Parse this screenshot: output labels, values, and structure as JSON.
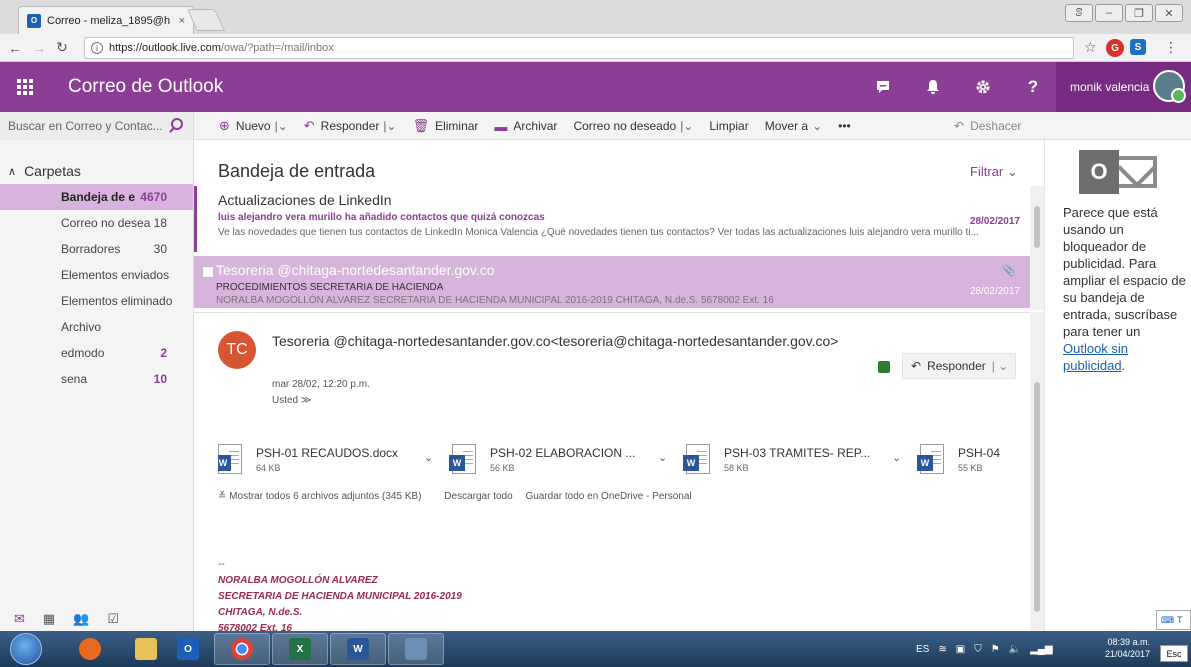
{
  "browser": {
    "tab_title": "Correo - meliza_1895@h",
    "tab_close": "×",
    "favicon": "O",
    "url_host": "https://outlook.live.com",
    "url_path": "/owa/?path=/mail/inbox",
    "win_buttons": [
      "ꕷ",
      "–",
      "❐",
      "✕"
    ]
  },
  "header": {
    "app_title": "Correo de Outlook",
    "user_name": "monik valencia",
    "icons": [
      "chat-icon",
      "bell-icon",
      "gear-icon",
      "help-icon"
    ],
    "help_glyph": "?"
  },
  "search": {
    "placeholder": "Buscar en Correo y Contac..."
  },
  "toolbar": {
    "new": "Nuevo",
    "reply": "Responder",
    "delete": "Eliminar",
    "archive": "Archivar",
    "junk": "Correo no deseado",
    "sweep": "Limpiar",
    "move": "Mover a",
    "more": "•••",
    "undo": "Deshacer"
  },
  "folders": {
    "header": "Carpetas",
    "items": [
      {
        "label": "Bandeja de e",
        "count": "4670"
      },
      {
        "label": "Correo no desea",
        "count": "18"
      },
      {
        "label": "Borradores",
        "count": "30"
      },
      {
        "label": "Elementos enviados",
        "count": ""
      },
      {
        "label": "Elementos eliminado",
        "count": ""
      },
      {
        "label": "Archivo",
        "count": ""
      },
      {
        "label": "edmodo",
        "count": "2"
      },
      {
        "label": "sena",
        "count": "10"
      }
    ]
  },
  "list": {
    "title": "Bandeja de entrada",
    "filter": "Filtrar",
    "messages": [
      {
        "sender": "Actualizaciones de LinkedIn",
        "subject": "luis alejandro vera murillo ha añadido contactos que quizá conozcas",
        "preview": "Ve las novedades que tienen tus contactos de LinkedIn Monica Valencia  ¿Qué novedades tienen tus contactos? Ver todas las actualizaciones     luis alejandro vera murillo ti...",
        "date": "28/02/2017"
      },
      {
        "sender": "Tesoreria @chitaga-nortedesantander.gov.co",
        "subject": "PROCEDIMIENTOS SECRETARIA DE HACIENDA",
        "preview": "NORALBA MOGOLLÓN ALVAREZ SECRETARIA DE HACIENDA MUNICIPAL 2016-2019 CHITAGA, N.de.S. 5678002 Ext. 16",
        "date": "28/02/2017"
      }
    ]
  },
  "reading": {
    "avatar_initials": "TC",
    "from": "Tesoreria @chitaga-nortedesantander.gov.co<tesoreria@chitaga-nortedesantander.gov.co>",
    "date": "mar 28/02, 12:20 p.m.",
    "to": "Usted",
    "reply": "Responder",
    "attachments": [
      {
        "name": "PSH-01 RECAUDOS.docx",
        "size": "64 KB"
      },
      {
        "name": "PSH-02 ELABORACION ...",
        "size": "56 KB"
      },
      {
        "name": "PSH-03 TRAMITES- REP...",
        "size": "58 KB"
      },
      {
        "name": "PSH-04",
        "size": "55 KB"
      }
    ],
    "show_all": "Mostrar todos 6 archivos adjuntos (345 KB)",
    "download_all": "Descargar todo",
    "save_onedrive": "Guardar todo en OneDrive - Personal",
    "signature": {
      "dash": "--",
      "name": "NORALBA MOGOLLÓN ALVAREZ",
      "role": "SECRETARIA DE HACIENDA MUNICIPAL 2016-2019",
      "city": "CHITAGA, N.de.S.",
      "phone": "5678002 Ext. 16"
    }
  },
  "ad": {
    "text": "Parece que está usando un bloqueador de publicidad. Para ampliar el espacio de su bandeja de entrada, suscríbase para tener un ",
    "link": "Outlook sin publicidad",
    "end": "."
  },
  "taskbar": {
    "lang": "ES",
    "time": "08:39 a.m.",
    "date": "21/04/2017",
    "esc": "Esc",
    "ime": "T"
  }
}
